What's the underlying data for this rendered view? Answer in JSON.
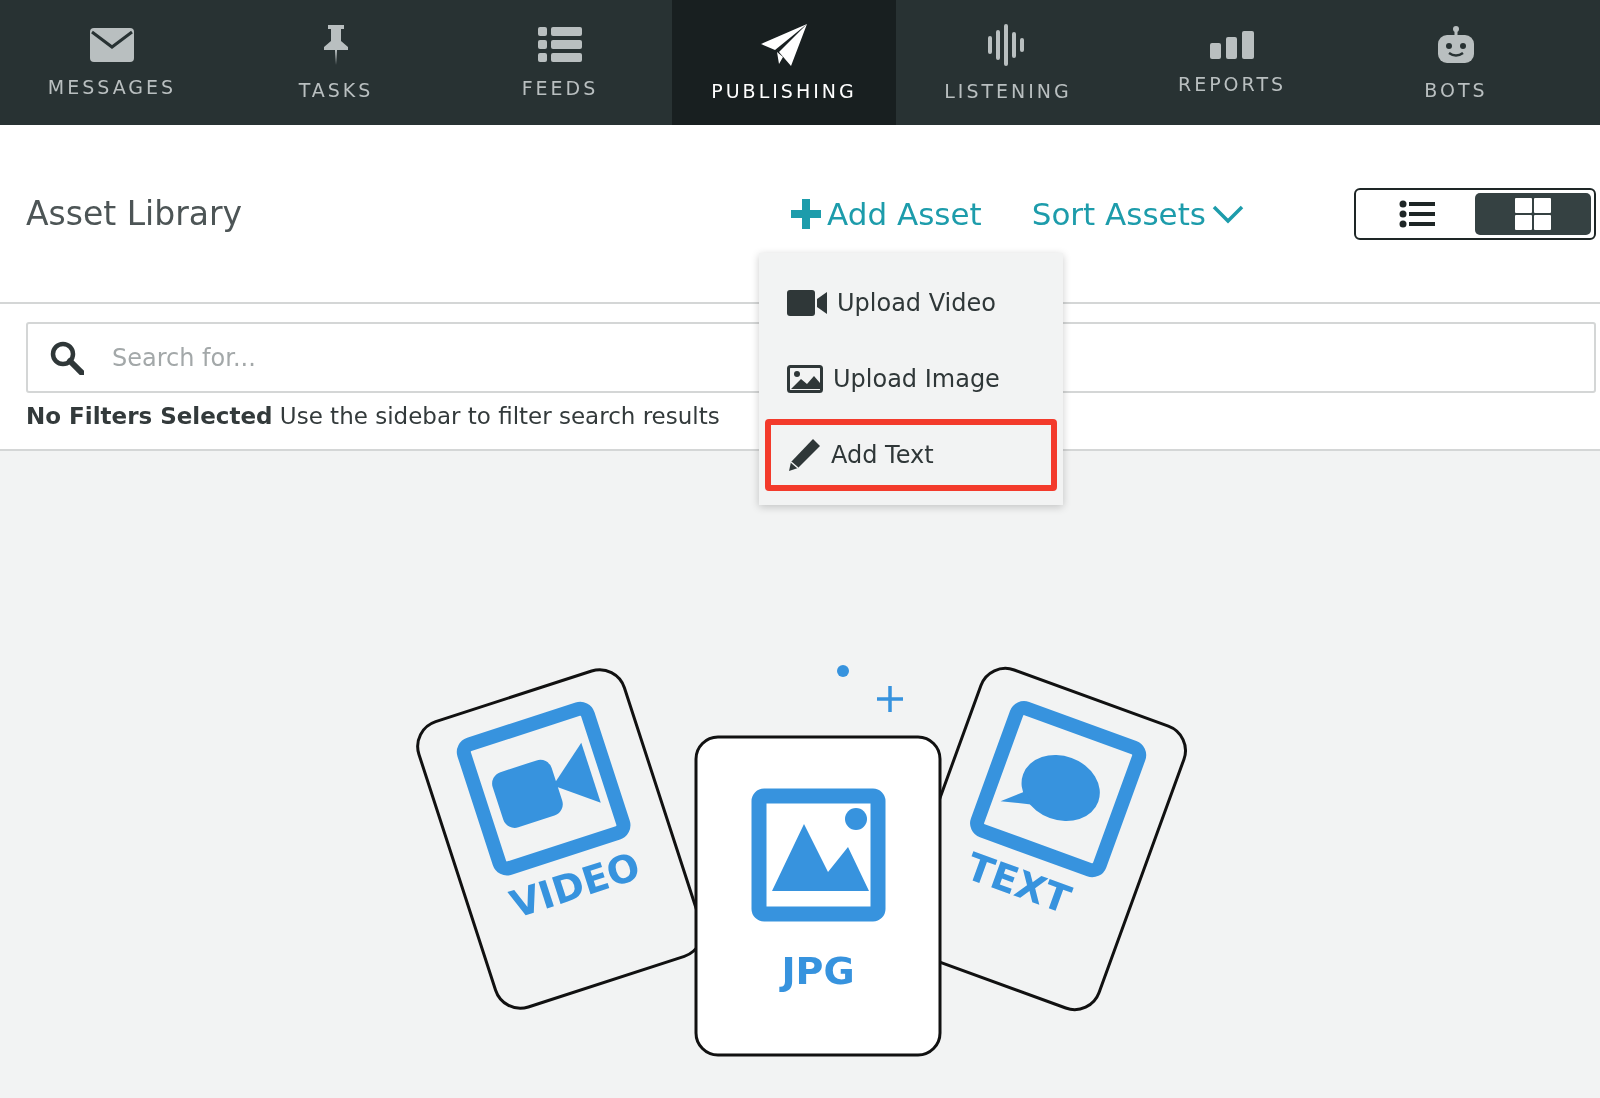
{
  "nav": [
    {
      "label": "MESSAGES",
      "kind": "envelope",
      "selected": false
    },
    {
      "label": "TASKS",
      "kind": "pin",
      "selected": false
    },
    {
      "label": "FEEDS",
      "kind": "list",
      "selected": false
    },
    {
      "label": "PUBLISHING",
      "kind": "plane",
      "selected": true
    },
    {
      "label": "LISTENING",
      "kind": "wave",
      "selected": false
    },
    {
      "label": "REPORTS",
      "kind": "bars",
      "selected": false
    },
    {
      "label": "BOTS",
      "kind": "robot",
      "selected": false
    }
  ],
  "header": {
    "title": "Asset Library",
    "add_asset": "Add Asset",
    "sort_assets": "Sort Assets",
    "views": [
      {
        "kind": "list",
        "selected": false
      },
      {
        "kind": "grid",
        "selected": true
      }
    ]
  },
  "menu": [
    {
      "kind": "video",
      "label": "Upload Video",
      "highlighted": false
    },
    {
      "kind": "image",
      "label": "Upload Image",
      "highlighted": false
    },
    {
      "kind": "text",
      "label": "Add Text",
      "highlighted": true
    }
  ],
  "search": {
    "placeholder": "Search for..."
  },
  "filters": {
    "title": "No Filters Selected",
    "hint": "Use the sidebar to filter search results"
  },
  "illustration": {
    "labels": [
      "VIDEO",
      "JPG",
      "TEXT"
    ]
  }
}
